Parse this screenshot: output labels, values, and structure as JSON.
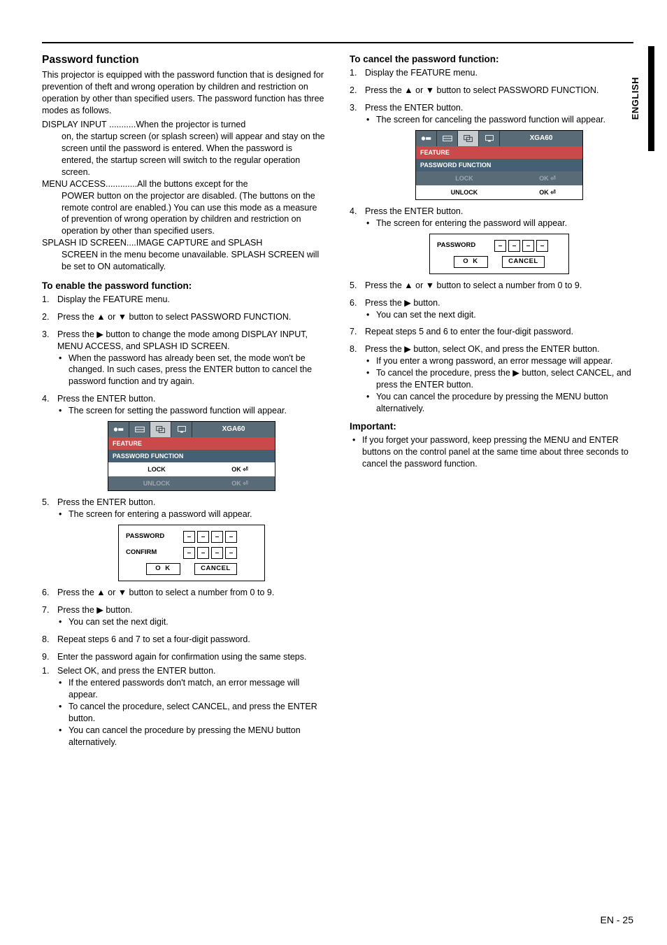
{
  "side_label": "ENGLISH",
  "left": {
    "h2": "Password function",
    "intro": "This projector is equipped with the password function that is designed for prevention of theft and wrong operation by children and restriction on operation by other than specified users. The password function has three modes as follows.",
    "modes": [
      {
        "term": "DISPLAY INPUT",
        "dots": " ...........",
        "desc": "When the projector is turned",
        "cont": "on, the startup screen (or splash screen) will appear and stay on the screen until the password is entered. When the password is entered, the startup screen will switch to the regular operation screen."
      },
      {
        "term": "MENU ACCESS",
        "dots": ".............",
        "desc": "All the buttons except for the",
        "cont": "POWER button on the projector are disabled. (The buttons on the remote control are enabled.) You can use this mode as a measure of prevention of wrong operation by children and restriction on operation by other than specified users."
      },
      {
        "term": "SPLASH ID SCREEN",
        "dots": "....",
        "desc": "IMAGE CAPTURE and SPLASH",
        "cont": "SCREEN in the menu become unavailable. SPLASH SCREEN will be set to ON automatically."
      }
    ],
    "enable_h": "To enable the password function:",
    "steps_a": [
      "Display the FEATURE menu.",
      "Press the ▲ or ▼ button to select PASSWORD FUNCTION.",
      "Press the ▶ button to change the mode among DISPLAY INPUT, MENU ACCESS, and SPLASH ID SCREEN.",
      "Press the ENTER button."
    ],
    "step3_bullets": [
      "When the password has already been set, the mode won't be changed. In such cases, press the ENTER button to cancel the password function and try again."
    ],
    "step4_bullets": [
      "The screen for setting the password function will appear."
    ],
    "menu": {
      "tab_label": "XGA60",
      "header": "FEATURE",
      "sub": "PASSWORD FUNCTION",
      "lock": "LOCK",
      "unlock": "UNLOCK",
      "ok": "OK"
    },
    "steps_b_start": 5,
    "step5": "Press the ENTER button.",
    "step5_bullets": [
      "The screen for entering a password will appear."
    ],
    "pw": {
      "password": "PASSWORD",
      "confirm": "CONFIRM",
      "digit": "–",
      "ok": "O K",
      "cancel": "CANCEL"
    },
    "step6": "Press the ▲ or ▼ button to select a number from 0 to 9.",
    "step7": "Press the ▶ button.",
    "step7_bullets": [
      "You can set the next digit."
    ],
    "step8": "Repeat steps 6 and 7 to set a four-digit password.",
    "step9": "Enter the password again for confirmation using the same steps.",
    "step10": "Select OK, and press the ENTER button.",
    "step10_bullets": [
      "If the entered passwords don't match, an error message will appear.",
      "To cancel the procedure, select CANCEL, and press the ENTER button.",
      "You can cancel the procedure by pressing the MENU button alternatively."
    ]
  },
  "right": {
    "cancel_h": "To cancel the password function:",
    "steps_a": [
      "Display the FEATURE menu.",
      "Press the ▲ or ▼ button to select PASSWORD FUNCTION.",
      "Press the ENTER button."
    ],
    "step3_bullets": [
      "The screen for canceling the password function will appear."
    ],
    "step4": "Press the ENTER button.",
    "step4_bullets": [
      "The screen for entering the password will appear."
    ],
    "pw_small": {
      "password": "PASSWORD",
      "digit": "–",
      "ok": "O K",
      "cancel": "CANCEL"
    },
    "step5": "Press the ▲ or ▼ button to select a number from 0 to 9.",
    "step6": "Press the ▶ button.",
    "step6_bullets": [
      "You can set the next digit."
    ],
    "step7": "Repeat steps 5 and 6 to enter the four-digit password.",
    "step8": "Press the ▶ button, select OK, and press the ENTER button.",
    "step8_bullets": [
      "If you enter a wrong password, an error message will appear.",
      "To cancel the procedure, press the ▶ button, select CANCEL, and press the ENTER button.",
      "You can cancel the procedure by pressing the MENU button alternatively."
    ],
    "important_h": "Important:",
    "important_bullets": [
      "If you forget your password, keep pressing the MENU and ENTER buttons on the control panel at the same time about three seconds to cancel the password function."
    ]
  },
  "footer": "EN - 25"
}
